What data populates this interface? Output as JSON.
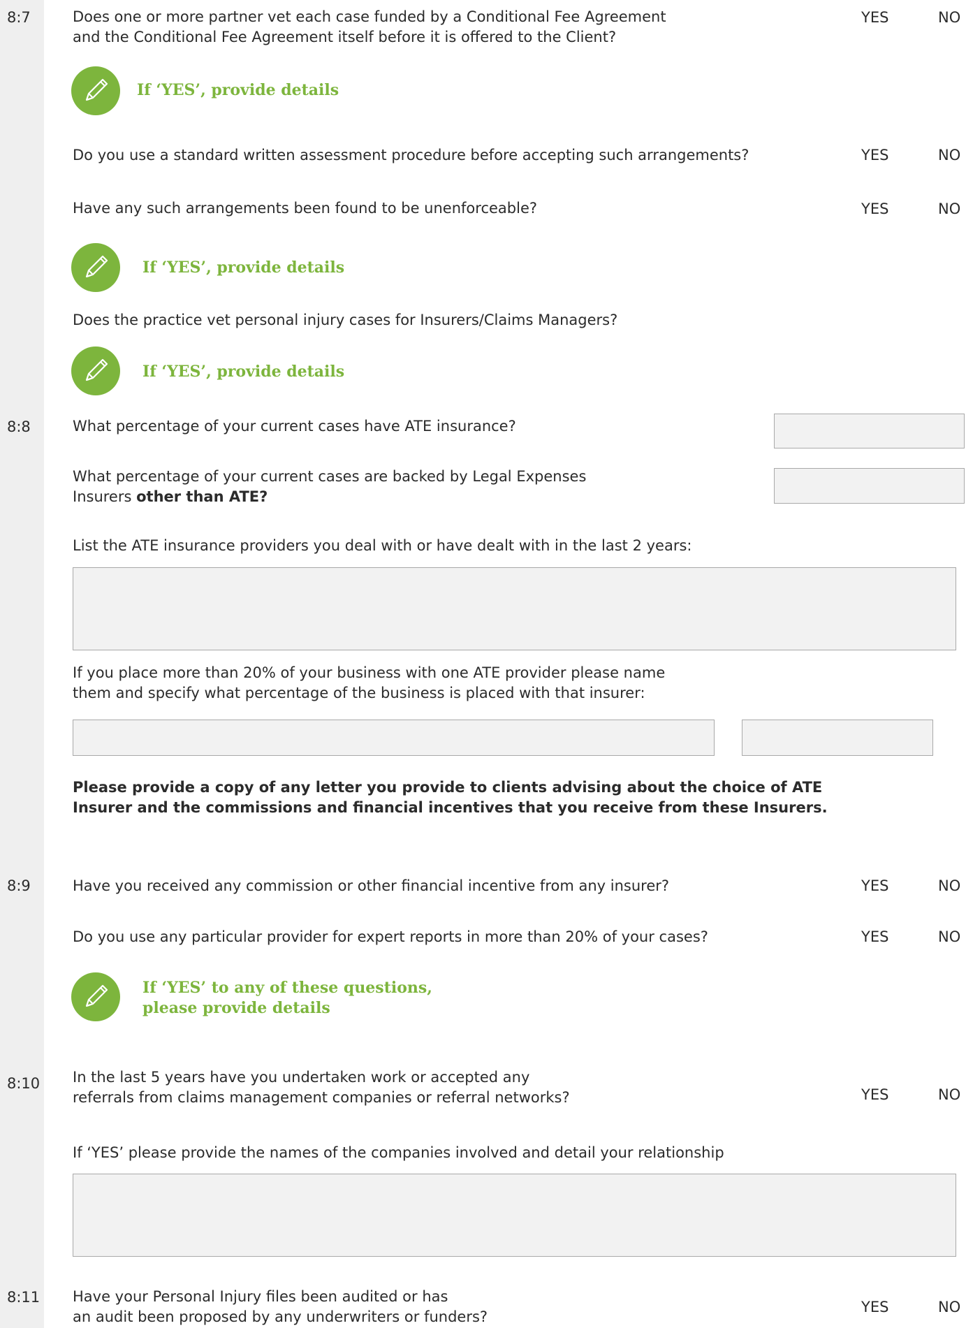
{
  "yes": "YES",
  "no": "NO",
  "s87": {
    "num": "8:7",
    "q1a": "Does one or more partner vet each case funded by a Conditional Fee Agreement",
    "q1b": "and the Conditional Fee Agreement itself before it is offered to the Client?",
    "details1": "If ‘YES’,  provide details",
    "q2": "Do you use a standard written assessment procedure before accepting such arrangements?",
    "q3": "Have any such arrangements been found to be unenforceable?",
    "details2": "If ‘YES’,  provide details",
    "q4": "Does the practice vet personal injury cases for Insurers/Claims Managers?",
    "details3": "If ‘YES’,  provide details"
  },
  "s88": {
    "num": "8:8",
    "q1": "What percentage of your current cases have ATE insurance?",
    "q2a": "What percentage of your current cases are backed by Legal Expenses",
    "q2b_pre": "Insurers ",
    "q2b_bold": "other than ATE?",
    "q3": "List the ATE insurance providers you deal with or have dealt with in the last 2 years:",
    "q4a": "If you place more than 20% of your business with one ATE provider please name",
    "q4b": "them and specify what percentage of the business is placed with that insurer:",
    "note_a": "Please provide a copy of any letter you provide to clients advising about the choice of ATE",
    "note_b": "Insurer and the commissions and financial incentives that you receive from these Insurers."
  },
  "s89": {
    "num": "8:9",
    "q1": "Have you received any commission or other financial incentive from any insurer?",
    "q2": "Do you use any particular provider for expert reports in more than 20% of your cases?",
    "details_a": "If ‘YES’ to any of these questions,",
    "details_b": "please provide details"
  },
  "s810": {
    "num": "8:10",
    "q1a": "In the last 5 years have you undertaken work or accepted any",
    "q1b": "referrals from claims management companies or referral networks?",
    "q2": "If ‘YES’ please provide the names of the companies involved and detail your relationship"
  },
  "s811": {
    "num": "8:11",
    "q1a": "Have your Personal Injury files been audited or has",
    "q1b": "an audit been proposed by any underwriters or funders?"
  }
}
